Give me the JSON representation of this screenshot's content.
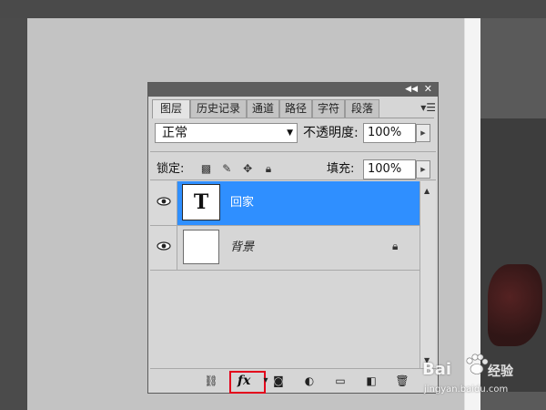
{
  "panel": {
    "tabs": [
      "图层",
      "历史记录",
      "通道",
      "路径",
      "字符",
      "段落"
    ],
    "blend_mode": "正常",
    "opacity_label": "不透明度:",
    "opacity_value": "100%",
    "lock_label": "锁定:",
    "fill_label": "填充:",
    "fill_value": "100%"
  },
  "layers": [
    {
      "name": "回家",
      "thumb": "T",
      "selected": true
    },
    {
      "name": "背景",
      "selected": false,
      "locked": true
    }
  ],
  "icons": {
    "collapse": "double-chevron-icon",
    "close": "close-icon",
    "panel_menu": "panel-menu-icon",
    "lock_icons": [
      "lock-transparent-icon",
      "lock-paint-icon",
      "lock-move-icon",
      "lock-all-icon"
    ],
    "bottom": [
      "link-icon",
      "fx-icon",
      "mask-icon",
      "adjustment-icon",
      "folder-icon",
      "new-layer-icon",
      "trash-icon"
    ]
  },
  "fx_label": "fx",
  "watermark": {
    "brand_left": "Bai",
    "brand_right": "经验",
    "url": "jingyan.baidu.com"
  },
  "colors": {
    "selected_row": "#2f8fff",
    "highlight": "#e3001b"
  }
}
